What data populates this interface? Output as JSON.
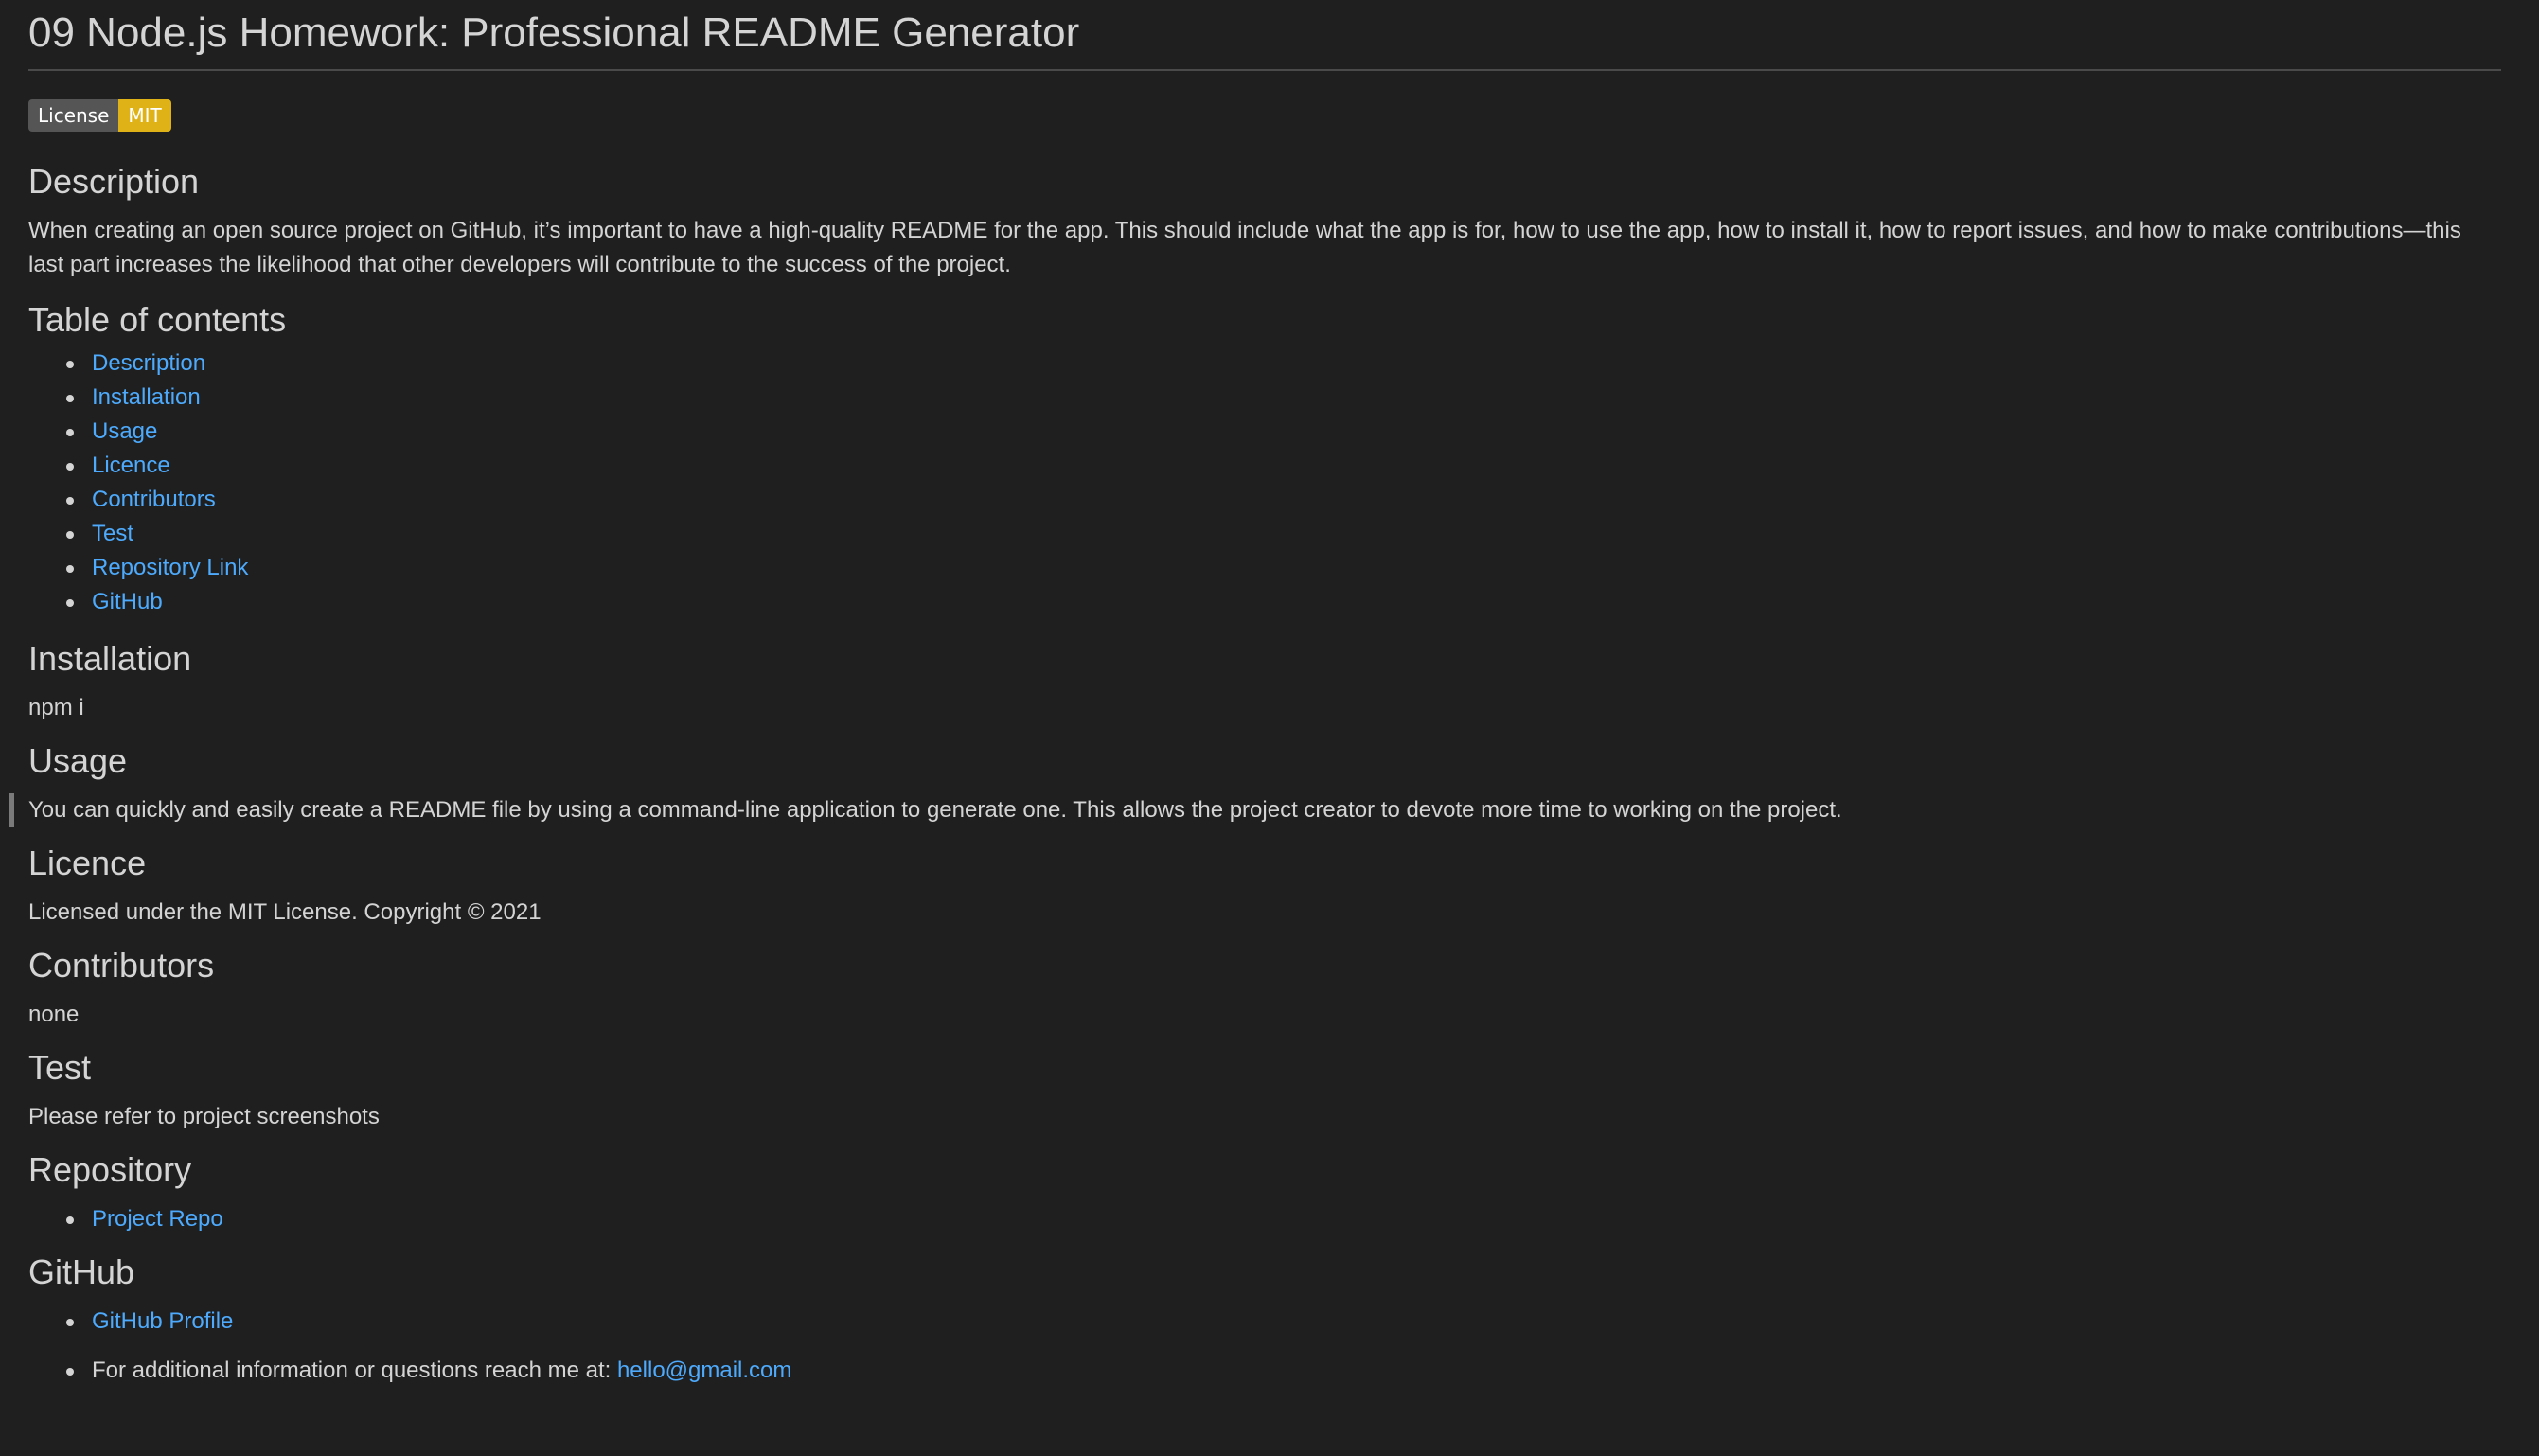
{
  "title": "09 Node.js Homework: Professional README Generator",
  "badge": {
    "label": "License",
    "value": "MIT",
    "label_color": "#555555",
    "value_color": "#dfb317"
  },
  "sections": {
    "description": {
      "heading": "Description",
      "text": "When creating an open source project on GitHub, it’s important to have a high-quality README for the app. This should include what the app is for, how to use the app, how to install it, how to report issues, and how to make contributions—this last part increases the likelihood that other developers will contribute to the success of the project."
    },
    "toc": {
      "heading": "Table of contents",
      "items": [
        "Description",
        "Installation",
        "Usage",
        "Licence",
        "Contributors",
        "Test",
        "Repository Link",
        "GitHub"
      ]
    },
    "installation": {
      "heading": "Installation",
      "text": "npm i"
    },
    "usage": {
      "heading": "Usage",
      "text": "You can quickly and easily create a README file by using a command-line application to generate one. This allows the project creator to devote more time to working on the project."
    },
    "licence": {
      "heading": "Licence",
      "text": "Licensed under the MIT License. Copyright © 2021"
    },
    "contributors": {
      "heading": "Contributors",
      "text": "none"
    },
    "test": {
      "heading": "Test",
      "text": "Please refer to project screenshots"
    },
    "repository": {
      "heading": "Repository",
      "link": "Project Repo"
    },
    "github": {
      "heading": "GitHub",
      "profile_link": "GitHub Profile",
      "contact_prefix": "For additional information or questions reach me at: ",
      "email": "hello@gmail.com"
    }
  },
  "colors": {
    "background": "#1f1f1f",
    "text": "#d4d4d4",
    "link": "#4daafc"
  }
}
